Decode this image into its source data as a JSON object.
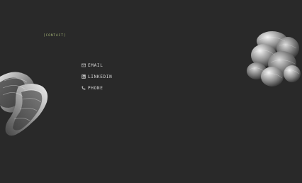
{
  "section": {
    "label": "[CONTACT]"
  },
  "contacts": [
    {
      "label": "EMAIL",
      "icon": "mail-icon"
    },
    {
      "label": "LINKEDIN",
      "icon": "linkedin-icon"
    },
    {
      "label": "PHONE",
      "icon": "phone-icon"
    }
  ],
  "colors": {
    "background": "#292929",
    "accent": "#a8b878",
    "text": "#d8d8d8"
  }
}
